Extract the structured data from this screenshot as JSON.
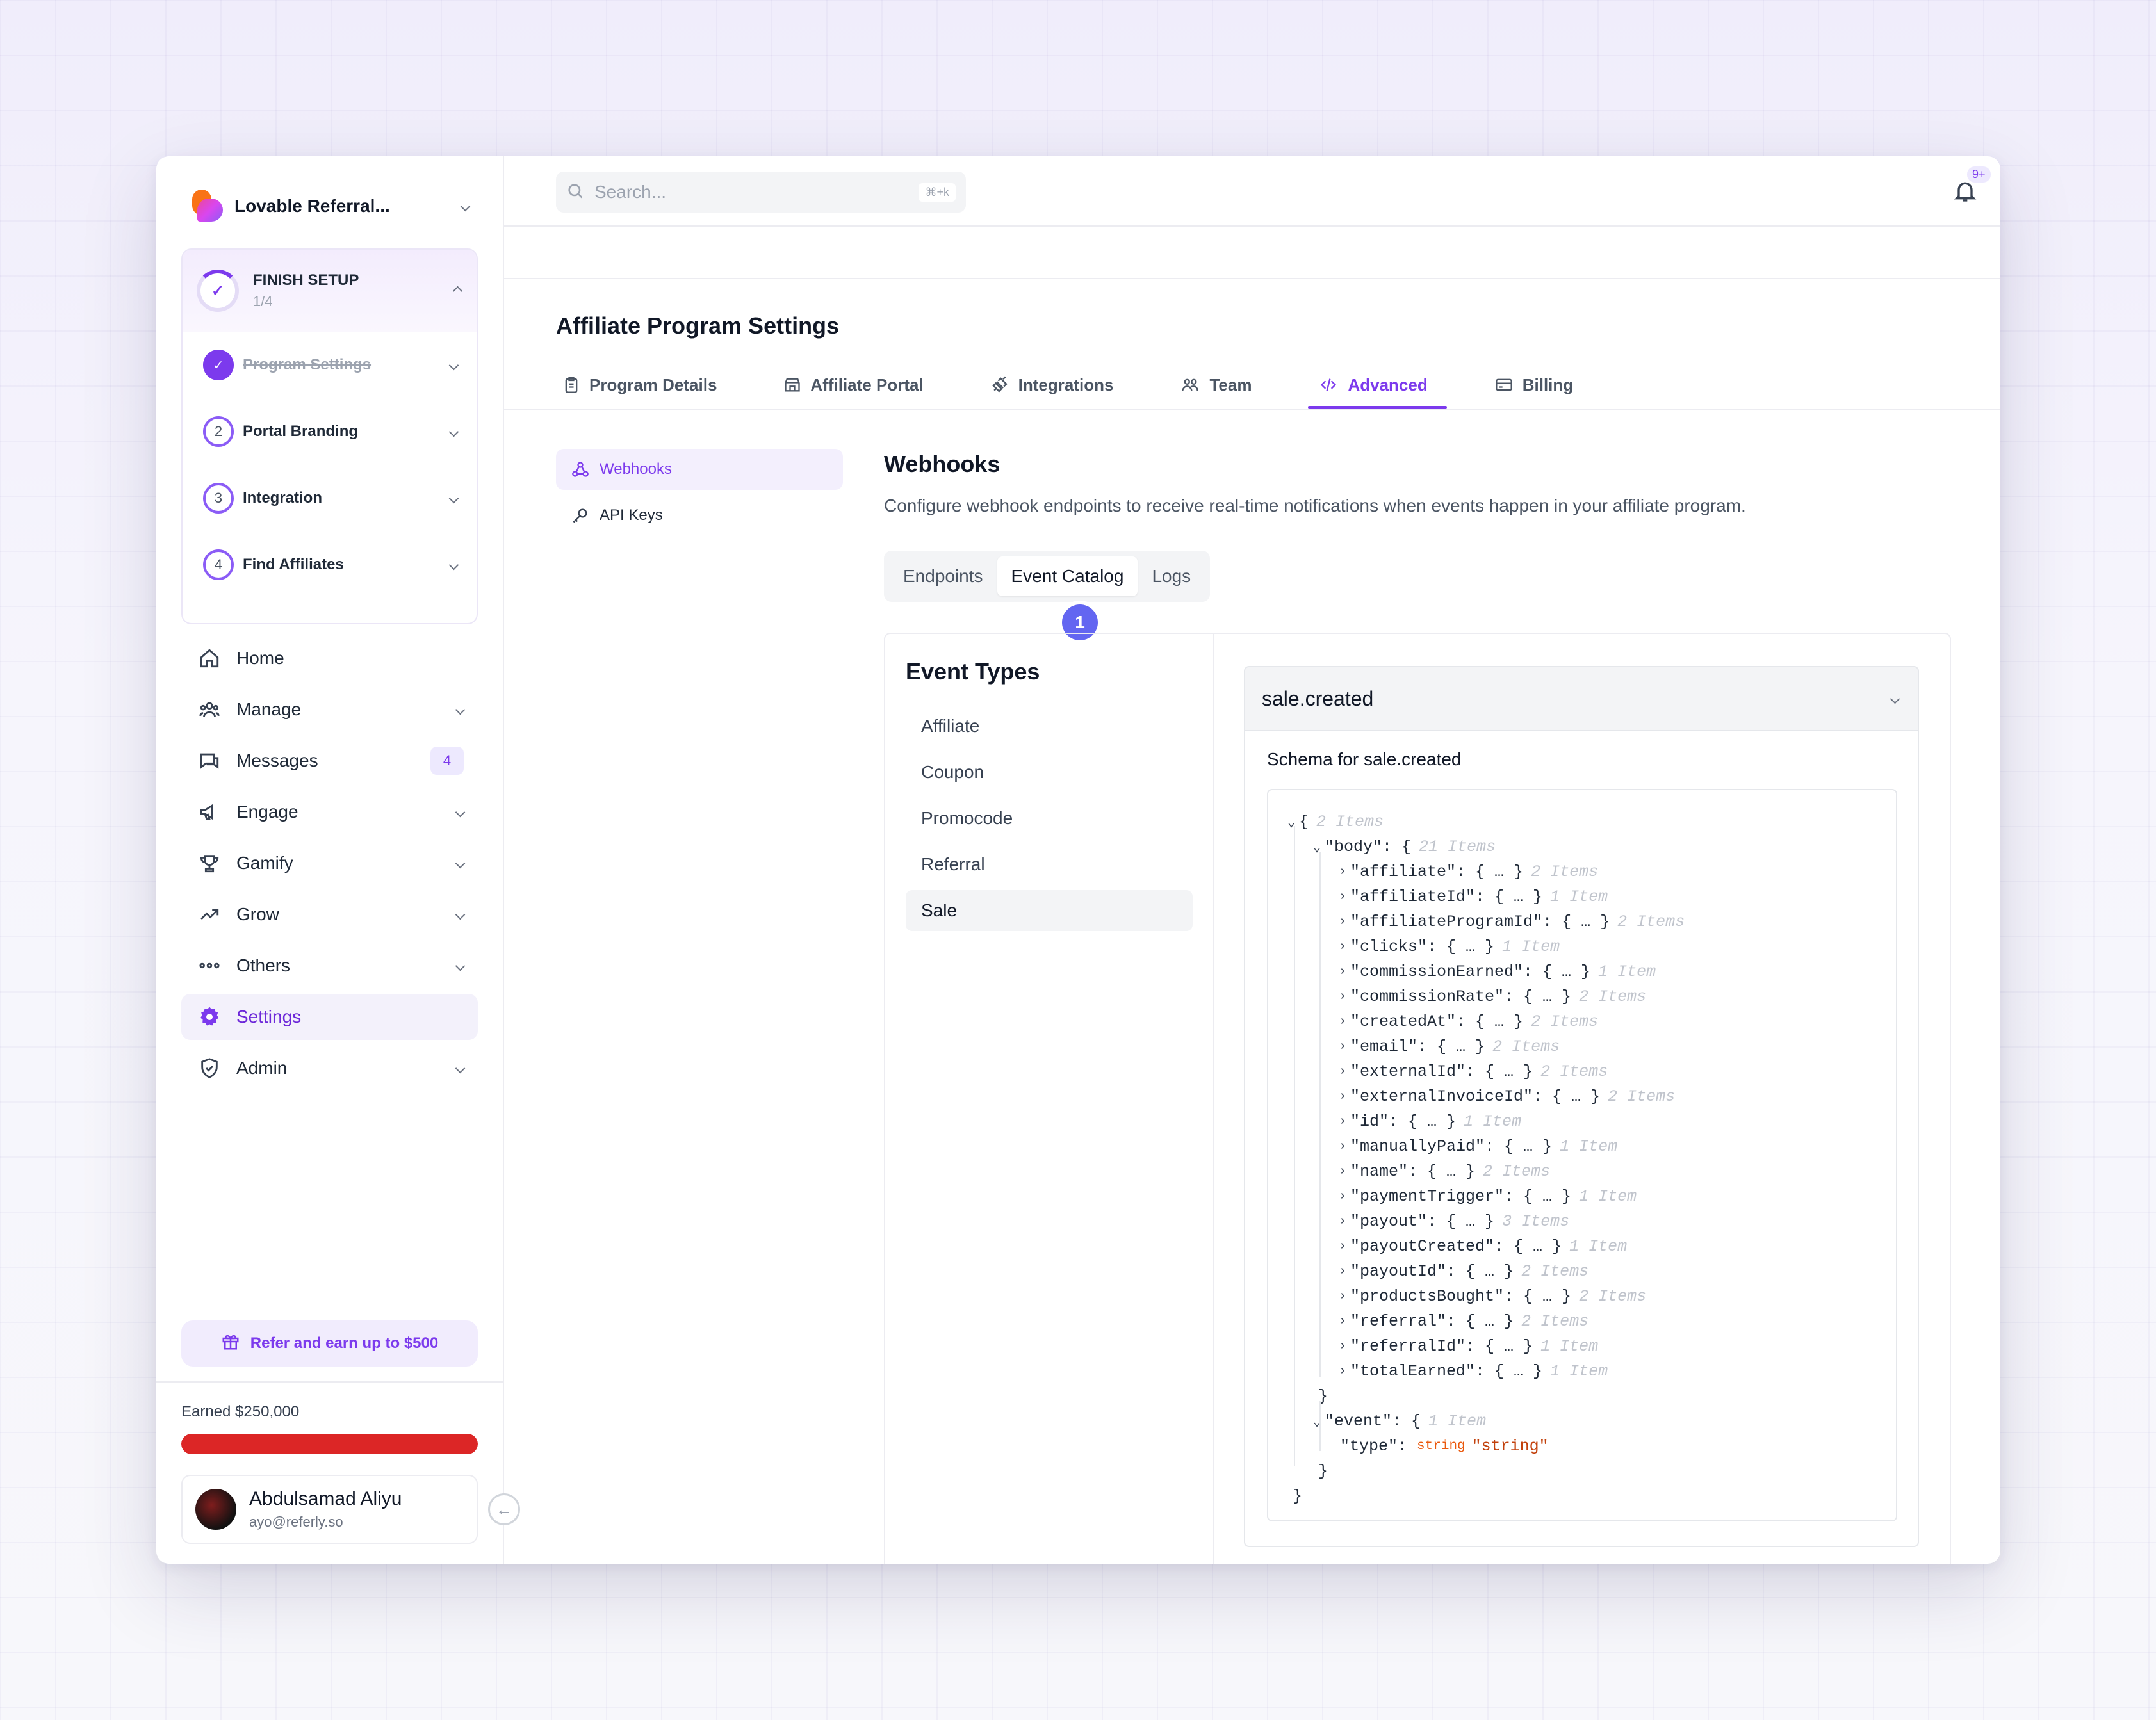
{
  "brand": {
    "name": "Lovable Referral..."
  },
  "setup": {
    "title": "FINISH SETUP",
    "progress": "1/4",
    "steps": [
      {
        "num": "✓",
        "label": "Program Settings",
        "done": true
      },
      {
        "num": "2",
        "label": "Portal Branding",
        "done": false
      },
      {
        "num": "3",
        "label": "Integration",
        "done": false
      },
      {
        "num": "4",
        "label": "Find Affiliates",
        "done": false
      }
    ]
  },
  "nav": {
    "home": "Home",
    "manage": "Manage",
    "messages": "Messages",
    "messages_badge": "4",
    "engage": "Engage",
    "gamify": "Gamify",
    "grow": "Grow",
    "others": "Others",
    "settings": "Settings",
    "admin": "Admin"
  },
  "refer": {
    "label": "Refer and earn up to $500"
  },
  "earnings": {
    "label": "Earned $250,000",
    "progress_fraction": 1.0,
    "bar_color": "#dc2626"
  },
  "user": {
    "name": "Abdulsamad Aliyu",
    "email": "ayo@referly.so"
  },
  "search": {
    "placeholder": "Search...",
    "shortcut": "⌘+k"
  },
  "notifications": {
    "badge": "9+"
  },
  "page": {
    "title": "Affiliate Program Settings",
    "tabs": [
      "Program Details",
      "Affiliate Portal",
      "Integrations",
      "Team",
      "Advanced",
      "Billing"
    ],
    "active_tab": "Advanced"
  },
  "subnav": {
    "webhooks": "Webhooks",
    "api_keys": "API Keys"
  },
  "webhooks": {
    "title": "Webhooks",
    "description": "Configure webhook endpoints to receive real-time notifications when events happen in your affiliate program.",
    "segments": [
      "Endpoints",
      "Event Catalog",
      "Logs"
    ],
    "active_segment": "Event Catalog",
    "step_marker": "1"
  },
  "event_types": {
    "title": "Event Types",
    "items": [
      "Affiliate",
      "Coupon",
      "Promocode",
      "Referral",
      "Sale"
    ],
    "active": "Sale"
  },
  "event": {
    "name": "sale.created",
    "schema_title": "Schema for sale.created",
    "root_meta": "2 Items",
    "body_key": "\"body\"",
    "body_meta": "21 Items",
    "fields": [
      {
        "key": "\"affiliate\"",
        "meta": "2 Items"
      },
      {
        "key": "\"affiliateId\"",
        "meta": "1 Item"
      },
      {
        "key": "\"affiliateProgramId\"",
        "meta": "2 Items"
      },
      {
        "key": "\"clicks\"",
        "meta": "1 Item"
      },
      {
        "key": "\"commissionEarned\"",
        "meta": "1 Item"
      },
      {
        "key": "\"commissionRate\"",
        "meta": "2 Items"
      },
      {
        "key": "\"createdAt\"",
        "meta": "2 Items"
      },
      {
        "key": "\"email\"",
        "meta": "2 Items"
      },
      {
        "key": "\"externalId\"",
        "meta": "2 Items"
      },
      {
        "key": "\"externalInvoiceId\"",
        "meta": "2 Items"
      },
      {
        "key": "\"id\"",
        "meta": "1 Item"
      },
      {
        "key": "\"manuallyPaid\"",
        "meta": "1 Item"
      },
      {
        "key": "\"name\"",
        "meta": "2 Items"
      },
      {
        "key": "\"paymentTrigger\"",
        "meta": "1 Item"
      },
      {
        "key": "\"payout\"",
        "meta": "3 Items"
      },
      {
        "key": "\"payoutCreated\"",
        "meta": "1 Item"
      },
      {
        "key": "\"payoutId\"",
        "meta": "2 Items"
      },
      {
        "key": "\"productsBought\"",
        "meta": "2 Items"
      },
      {
        "key": "\"referral\"",
        "meta": "2 Items"
      },
      {
        "key": "\"referralId\"",
        "meta": "1 Item"
      },
      {
        "key": "\"totalEarned\"",
        "meta": "1 Item"
      }
    ],
    "event_key": "\"event\"",
    "event_meta": "1 Item",
    "type_key": "\"type\"",
    "type_type": "string",
    "type_value": "\"string\""
  }
}
